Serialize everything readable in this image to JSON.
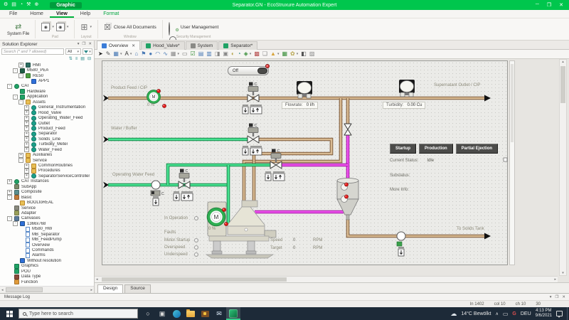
{
  "window": {
    "title": "Separator.GN - EcoStruxure Automation Expert",
    "app_tab": "Graphic",
    "qat_icons": [
      {
        "name": "settings-gear-icon",
        "glyph": "⚙"
      },
      {
        "name": "save-icon",
        "glyph": "▤"
      },
      {
        "name": "progress-icon",
        "glyph": "◔"
      },
      {
        "name": "tools-icon",
        "glyph": "⚒"
      },
      {
        "name": "move-icon",
        "glyph": "⊕"
      }
    ],
    "controls": [
      {
        "name": "minimize-button",
        "glyph": "─"
      },
      {
        "name": "restore-button",
        "glyph": "❐"
      },
      {
        "name": "close-button",
        "glyph": "✕"
      }
    ]
  },
  "ribbon": {
    "tabs": [
      "File",
      "Home",
      "View",
      "Help",
      "Format"
    ],
    "active_tab": "View",
    "contextual_tab": "Format",
    "buttons": {
      "system_file": "System File",
      "close_all": "Close All Documents",
      "user_mgmt": "User Management"
    },
    "groups": {
      "pad": "Pad",
      "layout": "Layout",
      "window": "Window",
      "security": "Security Management"
    }
  },
  "solution_explorer": {
    "title": "Solution Explorer",
    "search_placeholder": "Search (* and ? allowed)",
    "filter_all": "All",
    "header_icons": [
      {
        "name": "dropdown-icon",
        "glyph": "▾"
      },
      {
        "name": "pin-icon",
        "glyph": "❐"
      },
      {
        "name": "close-panel-icon",
        "glyph": "✕"
      }
    ],
    "toolbar_icons": [
      {
        "name": "sort-asc-icon",
        "glyph": "⇅"
      },
      {
        "name": "sort-desc-icon",
        "glyph": "≡"
      },
      {
        "name": "group-icon",
        "glyph": "▤"
      },
      {
        "name": "collapse-all-icon",
        "glyph": "⊟"
      }
    ],
    "tree": [
      {
        "label": "HMI",
        "d": 3,
        "e": "+",
        "s": "box",
        "c": "#2e6e62"
      },
      {
        "label": "M580_PEA",
        "d": 2,
        "e": "-",
        "s": "box",
        "c": "#1e5e46"
      },
      {
        "label": "RE50",
        "d": 3,
        "e": "-",
        "s": "box",
        "c": "#4a9e3f"
      },
      {
        "label": "APP1",
        "d": 4,
        "s": "box",
        "c": "#2f6fd8"
      },
      {
        "label": "CAT",
        "d": 1,
        "e": "-",
        "s": "gear",
        "c": "#21a366"
      },
      {
        "label": "Hardware",
        "d": 2,
        "s": "box",
        "c": "#21a366"
      },
      {
        "label": "Application",
        "d": 2,
        "e": "-",
        "s": "box",
        "c": "#21a366"
      },
      {
        "label": "Assets",
        "d": 3,
        "e": "-",
        "s": "folder",
        "c": "#e8bf55"
      },
      {
        "label": "General_Instrumentation",
        "d": 4,
        "e": "+",
        "s": "gear",
        "c": "#1ba08a"
      },
      {
        "label": "Hood_Valve",
        "d": 4,
        "e": "+",
        "s": "gear",
        "c": "#1ba08a"
      },
      {
        "label": "Operating_Water_Feed",
        "d": 4,
        "e": "+",
        "s": "gear",
        "c": "#1ba08a"
      },
      {
        "label": "Outlet",
        "d": 4,
        "e": "+",
        "s": "gear",
        "c": "#1ba08a"
      },
      {
        "label": "Product_Feed",
        "d": 4,
        "e": "+",
        "s": "gear",
        "c": "#1ba08a"
      },
      {
        "label": "Separator",
        "d": 4,
        "e": "+",
        "s": "gear",
        "c": "#1ba08a"
      },
      {
        "label": "Solids_Line",
        "d": 4,
        "e": "+",
        "s": "gear",
        "c": "#1ba08a"
      },
      {
        "label": "Turbidity_Meter",
        "d": 4,
        "e": "+",
        "s": "gear",
        "c": "#1ba08a"
      },
      {
        "label": "Water_Feed",
        "d": 4,
        "e": "+",
        "s": "gear",
        "c": "#1ba08a"
      },
      {
        "label": "Auxiliaries",
        "d": 3,
        "e": "+",
        "s": "folder",
        "c": "#e8bf55"
      },
      {
        "label": "Service",
        "d": 3,
        "e": "-",
        "s": "folder",
        "c": "#e8bf55"
      },
      {
        "label": "CommonRoutines",
        "d": 4,
        "e": "+",
        "s": "folder",
        "c": "#e8bf55"
      },
      {
        "label": "Procedures",
        "d": 4,
        "e": "+",
        "s": "folder",
        "c": "#e8bf55"
      },
      {
        "label": "SeparatorServiceController",
        "d": 4,
        "e": "+",
        "s": "gear",
        "c": "#1ba08a"
      },
      {
        "label": "CAT Instances",
        "d": 1,
        "e": "+",
        "s": "gear",
        "c": "#21a366"
      },
      {
        "label": "SubApp",
        "d": 1,
        "s": "box",
        "c": "#7a8a6a"
      },
      {
        "label": "Composite",
        "d": 1,
        "e": "+",
        "s": "box",
        "c": "#5a8f8f"
      },
      {
        "label": "Basic",
        "d": 1,
        "e": "-",
        "s": "box",
        "c": "#c07a3a"
      },
      {
        "label": "BOOLtoREAL",
        "d": 2,
        "s": "folder",
        "c": "#e8bf55"
      },
      {
        "label": "Service",
        "d": 1,
        "s": "box",
        "c": "#8a8a7e"
      },
      {
        "label": "Adapter",
        "d": 1,
        "s": "box",
        "c": "#9aa05a"
      },
      {
        "label": "Canvases",
        "d": 1,
        "e": "-",
        "s": "box",
        "c": "#5a7a9a"
      },
      {
        "label": "1366x768",
        "d": 2,
        "e": "-",
        "s": "monitor",
        "c": "#2f6fd8"
      },
      {
        "label": "M580_HW",
        "d": 3,
        "s": "doc",
        "c": "#ffffff"
      },
      {
        "label": "MB_Separator",
        "d": 3,
        "s": "doc",
        "c": "#ffffff"
      },
      {
        "label": "MB_FeedPump",
        "d": 3,
        "s": "doc",
        "c": "#ffffff"
      },
      {
        "label": "Overview",
        "d": 3,
        "s": "doc",
        "c": "#ffffff"
      },
      {
        "label": "Commands",
        "d": 3,
        "s": "doc",
        "c": "#ffffff"
      },
      {
        "label": "Alarms",
        "d": 3,
        "s": "doc",
        "c": "#ffffff"
      },
      {
        "label": "Without resolution",
        "d": 2,
        "s": "monitor",
        "c": "#2f6fd8"
      },
      {
        "label": "Graphics",
        "d": 1,
        "s": "box",
        "c": "#21a366"
      },
      {
        "label": "POU",
        "d": 1,
        "s": "box",
        "c": "#21a366"
      },
      {
        "label": "Data Type",
        "d": 1,
        "s": "box",
        "c": "#8a4a3a"
      },
      {
        "label": "Function",
        "d": 1,
        "s": "box",
        "c": "#e09a3a"
      }
    ]
  },
  "editor": {
    "tabs": [
      {
        "label": "Overview",
        "color": "#3b7dd8",
        "active": true,
        "close": true
      },
      {
        "label": "Hood_Valve*",
        "color": "#21a366"
      },
      {
        "label": "System",
        "color": "#8a8a86"
      },
      {
        "label": "Separator*",
        "color": "#21a366"
      }
    ],
    "toolbar": [
      {
        "name": "cursor",
        "g": "➤",
        "c": "#222"
      },
      {
        "name": "pencil",
        "g": "✎",
        "c": "#555"
      },
      {
        "name": "fill-color",
        "g": "▦",
        "c": "#4a7ab5",
        "caret": 1
      },
      {
        "name": "text",
        "g": "A",
        "c": "#333",
        "caret": 1
      },
      {
        "name": "polygon",
        "g": "⌂",
        "c": "#4a7ab5"
      },
      {
        "name": "flag",
        "g": "⚑",
        "c": "#4a7ab5"
      },
      {
        "name": "ellipse",
        "g": "●",
        "c": "#4a7ab5"
      },
      {
        "name": "arc",
        "g": "◠",
        "c": "#4a7ab5"
      },
      {
        "name": "connector",
        "g": "∿",
        "c": "#4a7ab5"
      },
      {
        "name": "table",
        "g": "▦",
        "c": "#888",
        "caret": 1
      },
      {
        "name": "button-widget",
        "g": "▭",
        "c": "#666"
      },
      {
        "name": "checkbox-widget",
        "g": "☑",
        "c": "#3a8f3a"
      },
      {
        "name": "listbox-widget",
        "g": "▤",
        "c": "#4a7ab5"
      },
      {
        "name": "textbox-widget",
        "g": "▥",
        "c": "#4a7ab5"
      },
      {
        "name": "panel-widget",
        "g": "◨",
        "c": "#888"
      },
      {
        "name": "frame-widget",
        "g": "▣",
        "c": "#888"
      },
      {
        "name": "gauge-widget",
        "g": "◐",
        "c": "#b5a34a"
      },
      {
        "name": "dial-widget",
        "g": "◔",
        "c": "#3a8f8f"
      },
      {
        "name": "chart-widget",
        "g": "◈",
        "c": "#3a8f3a",
        "caret": 1
      },
      {
        "name": "image-widget",
        "g": "▩",
        "c": "#b54a4a"
      },
      {
        "name": "note",
        "g": "❏",
        "c": "#888"
      },
      {
        "name": "alarm-widget",
        "g": "▲",
        "c": "#d8a43a",
        "caret": 1
      },
      {
        "name": "grid-widget",
        "g": "▦",
        "c": "#3a8f3a"
      },
      {
        "name": "symbol-library",
        "g": "✿",
        "c": "#b5a34a",
        "caret": 1
      },
      {
        "name": "export",
        "g": "◧",
        "c": "#555"
      },
      {
        "name": "macro",
        "g": "▨",
        "c": "#888"
      }
    ],
    "bottom_tabs": [
      {
        "label": "Design",
        "active": true
      },
      {
        "label": "Source",
        "active": false
      }
    ]
  },
  "diagram": {
    "toggle_label": "Off",
    "feed_labels": {
      "product": "Product Feed / CIP",
      "water": "Water / Buffer",
      "operating": "Operating Water Feed",
      "supernatant": "Supernatant Outlet / CIP",
      "solids": "To Solids Tank"
    },
    "flowrate": {
      "label": "Flowrate:",
      "value": "0 l/h"
    },
    "turbidity": {
      "label": "Turbidity:",
      "value": "0.00 Cu"
    },
    "pump_m": "M",
    "valve_c": "C",
    "feed_pump_pct": "0 %",
    "separator_pct": "0 %",
    "buttons": [
      "Startup",
      "Production",
      "Partial Ejection"
    ],
    "status": {
      "current_label": "Current Status:",
      "current_value": "Idle",
      "sub_label": "Substatus:",
      "more_label": "More Info:"
    },
    "indicators": [
      {
        "label": "In Operation",
        "led": true
      },
      {
        "label": "Faults",
        "led": false
      },
      {
        "label": "Motor Startup",
        "led": true
      },
      {
        "label": "Overspeed",
        "led": true
      },
      {
        "label": "Underspeed",
        "led": true
      }
    ],
    "speed": {
      "label": "Speed",
      "value": "0",
      "unit": "RPM"
    },
    "target": {
      "label": "Target",
      "value": "0",
      "unit": "RPM"
    }
  },
  "message_log": {
    "title": "Message Log",
    "icons": [
      {
        "name": "dropdown-icon",
        "glyph": "▾"
      },
      {
        "name": "float-icon",
        "glyph": "❐"
      },
      {
        "name": "close-log-icon",
        "glyph": "✕"
      }
    ]
  },
  "status_bar": {
    "ln": "ln 1402",
    "col": "col 10",
    "ch": "ch 10",
    "extra": "30"
  },
  "taskbar": {
    "search_placeholder": "Type here to search",
    "icons": [
      {
        "n": "cortana",
        "g": "○",
        "c": "#e8e8e8"
      },
      {
        "n": "task-view",
        "g": "▣",
        "c": "#d8d8d8"
      },
      {
        "n": "edge",
        "shape": "edge"
      },
      {
        "n": "file-explorer",
        "shape": "folder"
      },
      {
        "n": "vault",
        "shape": "vault"
      },
      {
        "n": "mail",
        "g": "✉",
        "c": "#d9e7f4"
      },
      {
        "n": "automation-app",
        "shape": "app",
        "active": true
      }
    ],
    "tray": {
      "weather": "14°C Bewölkt",
      "lang": "DEU",
      "g_badge": "G",
      "time": "4:13 PM",
      "date": "9/6/2021"
    }
  }
}
